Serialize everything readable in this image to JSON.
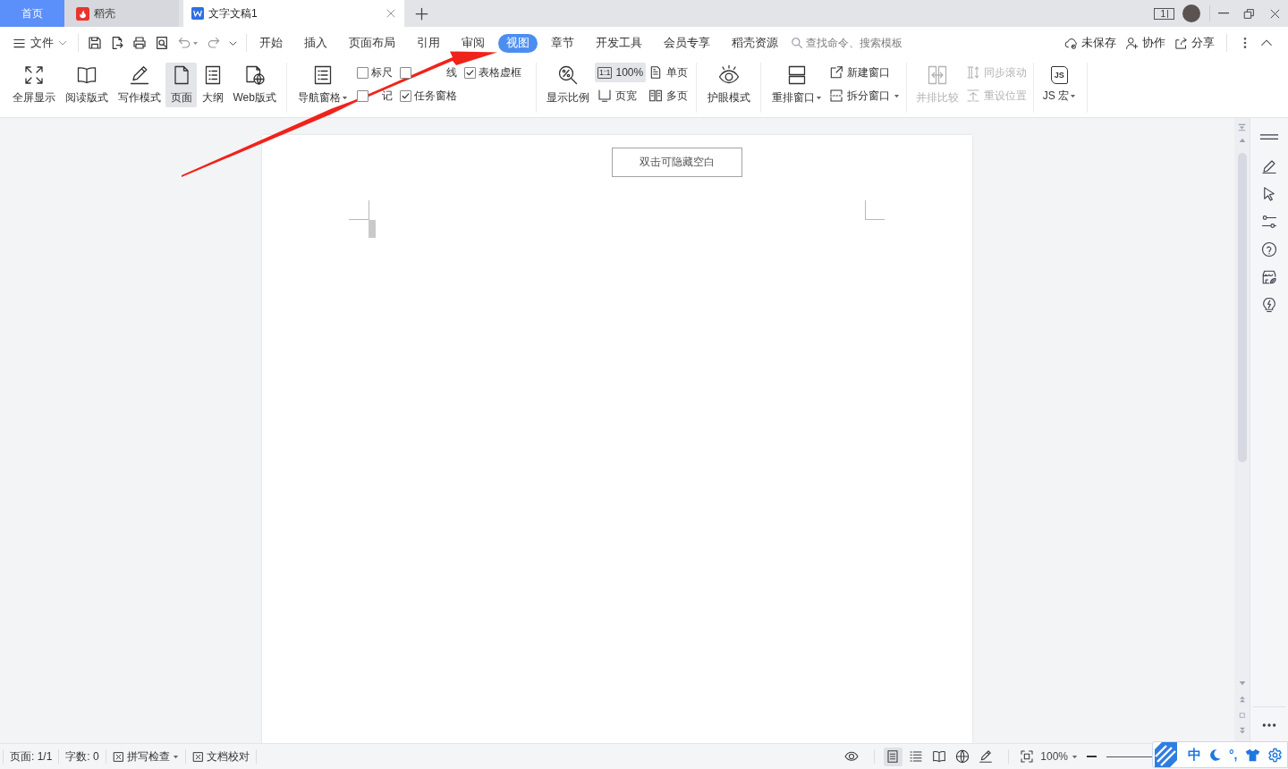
{
  "title_bar": {
    "tabs": [
      {
        "kind": "home",
        "label": "首页",
        "selected": false,
        "closable": false
      },
      {
        "kind": "docer",
        "label": "稻壳",
        "selected": false,
        "closable": false
      },
      {
        "kind": "writer",
        "label": "文字文稿1",
        "selected": true,
        "closable": true
      }
    ],
    "window_count": "1"
  },
  "menu_bar": {
    "file": "文件",
    "tabs": [
      {
        "label": "开始",
        "selected": false
      },
      {
        "label": "插入",
        "selected": false
      },
      {
        "label": "页面布局",
        "selected": false
      },
      {
        "label": "引用",
        "selected": false
      },
      {
        "label": "审阅",
        "selected": false
      },
      {
        "label": "视图",
        "selected": true
      },
      {
        "label": "章节",
        "selected": false
      },
      {
        "label": "开发工具",
        "selected": false
      },
      {
        "label": "会员专享",
        "selected": false
      },
      {
        "label": "稻壳资源",
        "selected": false
      }
    ],
    "search": {
      "placeholder": "查找命令、搜索模板"
    },
    "actions": [
      {
        "kind": "cloud",
        "label": "未保存"
      },
      {
        "kind": "collaborate",
        "label": "协作"
      },
      {
        "kind": "share",
        "label": "分享"
      }
    ]
  },
  "ribbon": {
    "layouts": [
      {
        "kind": "fullscreen",
        "label": "全屏显示",
        "selected": false
      },
      {
        "kind": "reading",
        "label": "阅读版式",
        "selected": false
      },
      {
        "kind": "writing",
        "label": "写作模式",
        "selected": false
      },
      {
        "kind": "page",
        "label": "页面",
        "selected": true
      },
      {
        "kind": "outline",
        "label": "大纲",
        "selected": false
      },
      {
        "kind": "web",
        "label": "Web版式",
        "selected": false
      }
    ],
    "navigation": {
      "label": "导航窗格",
      "dropdown": true
    },
    "options": [
      {
        "label": "标尺",
        "checked": false
      },
      {
        "label": "线",
        "checked": false
      },
      {
        "label": "表格虚框",
        "checked": true
      },
      {
        "label": "记",
        "checked": false
      },
      {
        "label": "任务窗格",
        "checked": true
      }
    ],
    "zoom": {
      "label": "显示比例"
    },
    "page_views": [
      {
        "kind": "actual",
        "label": "100%",
        "badge": "1:1",
        "selected": true
      },
      {
        "kind": "width",
        "label": "页宽",
        "selected": false
      },
      {
        "kind": "single",
        "label": "单页",
        "selected": false
      },
      {
        "kind": "multi",
        "label": "多页",
        "selected": false
      }
    ],
    "eye_care": {
      "label": "护眼模式"
    },
    "arrange": {
      "label": "重排窗口",
      "dropdown": true,
      "disabled": false
    },
    "window_actions": [
      {
        "kind": "new",
        "label": "新建窗口",
        "dropdown": false,
        "disabled": false
      },
      {
        "kind": "split",
        "label": "拆分窗口",
        "dropdown": true,
        "disabled": false
      }
    ],
    "compare": {
      "label": "并排比较",
      "dropdown": false,
      "disabled": true
    },
    "scroll_actions": [
      {
        "kind": "sync",
        "label": "同步滚动",
        "dropdown": false,
        "disabled": true
      },
      {
        "kind": "reset",
        "label": "重设位置",
        "dropdown": false,
        "disabled": true
      }
    ],
    "macro": {
      "icon_text": "JS",
      "label": "JS 宏",
      "dropdown": true
    }
  },
  "document": {
    "hint": "双击可隐藏空白"
  },
  "status_bar": {
    "page": "页面: 1/1",
    "words": "字数: 0",
    "checks": [
      {
        "label": "拼写检查",
        "dropdown": true
      },
      {
        "label": "文档校对",
        "dropdown": false
      }
    ],
    "views": [
      {
        "kind": "eye",
        "selected": false
      },
      {
        "kind": "page",
        "selected": true
      },
      {
        "kind": "outline",
        "selected": false
      },
      {
        "kind": "reading",
        "selected": false
      },
      {
        "kind": "web",
        "selected": false
      },
      {
        "kind": "writing",
        "selected": false
      }
    ],
    "zoom": "100%"
  },
  "input_method": {
    "mode": "中",
    "punctuation": "°,"
  }
}
